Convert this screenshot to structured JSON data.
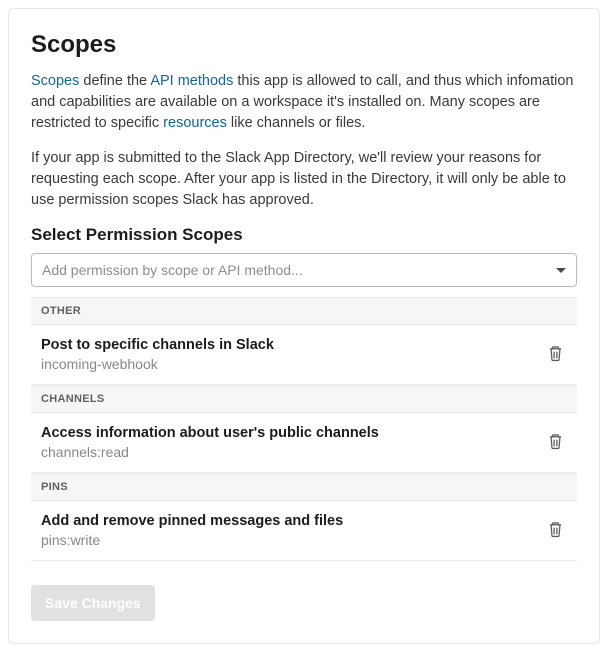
{
  "heading": "Scopes",
  "intro": {
    "link1": "Scopes",
    "text1": " define the ",
    "link2": "API methods",
    "text2": " this app is allowed to call, and thus which infomation and capabilities are available on a workspace it's installed on. Many scopes are restricted to specific ",
    "link3": "resources",
    "text3": " like channels or files."
  },
  "intro2": "If your app is submitted to the Slack App Directory, we'll review your reasons for requesting each scope. After your app is listed in the Directory, it will only be able to use permission scopes Slack has approved.",
  "select_label": "Select Permission Scopes",
  "combo_placeholder": "Add permission by scope or API method...",
  "groups": [
    {
      "label": "OTHER",
      "items": [
        {
          "title": "Post to specific channels in Slack",
          "name": "incoming-webhook"
        }
      ]
    },
    {
      "label": "CHANNELS",
      "items": [
        {
          "title": "Access information about user's public channels",
          "name": "channels:read"
        }
      ]
    },
    {
      "label": "PINS",
      "items": [
        {
          "title": "Add and remove pinned messages and files",
          "name": "pins:write"
        }
      ]
    }
  ],
  "save_label": "Save Changes"
}
